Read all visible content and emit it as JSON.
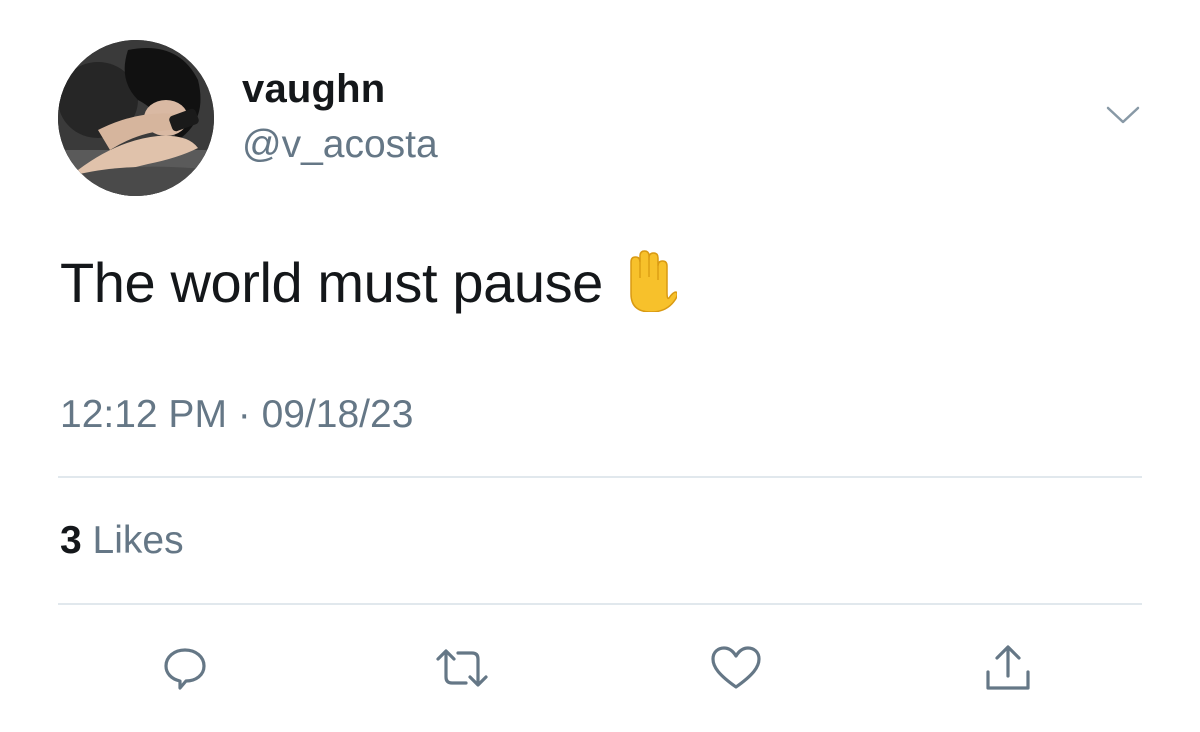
{
  "user": {
    "display_name": "vaughn",
    "handle": "@v_acosta",
    "avatar_icon": "profile-photo"
  },
  "tweet": {
    "text": "The world must pause",
    "emoji": "raised-hand-emoji",
    "timestamp": "12:12 PM · 09/18/23"
  },
  "stats": {
    "likes_count": "3",
    "likes_label": "Likes"
  },
  "actions": {
    "reply_icon": "reply-icon",
    "retweet_icon": "retweet-icon",
    "like_icon": "heart-icon",
    "share_icon": "share-icon"
  },
  "menu": {
    "caret_icon": "chevron-down-icon"
  },
  "colors": {
    "text_primary": "#14171a",
    "text_secondary": "#657786",
    "divider": "#e1e8ed",
    "icon": "#657786",
    "emoji": "#f7c12b"
  }
}
